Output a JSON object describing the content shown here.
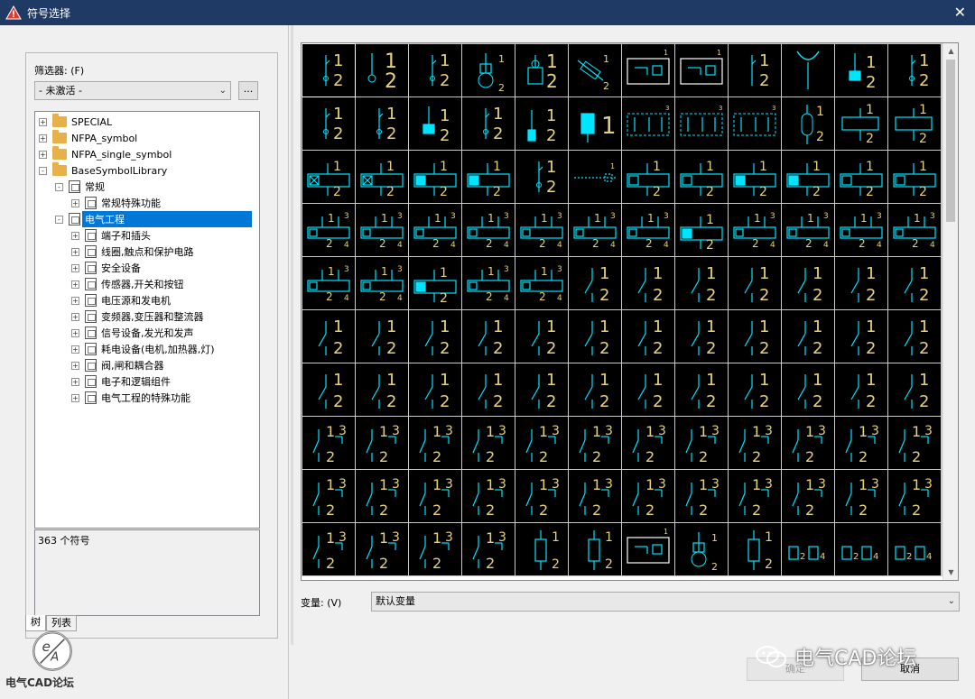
{
  "window": {
    "title": "符号选择",
    "close_glyph": "✕"
  },
  "filter": {
    "label": "筛选器: (F)",
    "value": "- 未激活 -",
    "browse_label": "..."
  },
  "tree": {
    "items": [
      {
        "label": "SPECIAL",
        "level": 0,
        "expander": "+",
        "icon": "folder-icon"
      },
      {
        "label": "NFPA_symbol",
        "level": 0,
        "expander": "+",
        "icon": "folder-icon"
      },
      {
        "label": "NFPA_single_symbol",
        "level": 0,
        "expander": "+",
        "icon": "folder-icon"
      },
      {
        "label": "BaseSymbolLibrary",
        "level": 0,
        "expander": "-",
        "icon": "folder-icon"
      },
      {
        "label": "常规",
        "level": 1,
        "expander": "-",
        "icon": "symbol-icon"
      },
      {
        "label": "常规特殊功能",
        "level": 2,
        "expander": "+",
        "icon": "symbol-icon"
      },
      {
        "label": "电气工程",
        "level": 1,
        "expander": "-",
        "icon": "symbol-icon",
        "selected": true
      },
      {
        "label": "端子和插头",
        "level": 2,
        "expander": "+",
        "icon": "symbol-icon"
      },
      {
        "label": "线圈,触点和保护电路",
        "level": 2,
        "expander": "+",
        "icon": "symbol-icon"
      },
      {
        "label": "安全设备",
        "level": 2,
        "expander": "+",
        "icon": "symbol-icon"
      },
      {
        "label": "传感器,开关和按钮",
        "level": 2,
        "expander": "+",
        "icon": "symbol-icon"
      },
      {
        "label": "电压源和发电机",
        "level": 2,
        "expander": "+",
        "icon": "symbol-icon"
      },
      {
        "label": "变频器,变压器和整流器",
        "level": 2,
        "expander": "+",
        "icon": "symbol-icon"
      },
      {
        "label": "信号设备,发光和发声",
        "level": 2,
        "expander": "+",
        "icon": "symbol-icon"
      },
      {
        "label": "耗电设备(电机,加热器,灯)",
        "level": 2,
        "expander": "+",
        "icon": "symbol-icon"
      },
      {
        "label": "阀,闸和耦合器",
        "level": 2,
        "expander": "+",
        "icon": "symbol-icon"
      },
      {
        "label": "电子和逻辑组件",
        "level": 2,
        "expander": "+",
        "icon": "symbol-icon"
      },
      {
        "label": "电气工程的特殊功能",
        "level": 2,
        "expander": "+",
        "icon": "symbol-icon"
      }
    ]
  },
  "count_text": "363 个符号",
  "tabs": [
    {
      "label": "树",
      "active": true
    },
    {
      "label": "列表",
      "active": false
    }
  ],
  "variant": {
    "label": "变量: (V)",
    "value": "默认变量"
  },
  "buttons": {
    "ok": "确定",
    "cancel": "取消"
  },
  "watermark": {
    "right_text": "电气CAD论坛",
    "left_text": "电气CAD论坛"
  },
  "colors": {
    "titlebar": "#1f3a64",
    "symbol_bg": "#000000",
    "symbol_cyan": "#00e5ff",
    "symbol_yellow": "#e6d27a",
    "selection": "#0078d7"
  },
  "symbols": {
    "rows": 10,
    "cols": 12,
    "kinds": [
      [
        "pin",
        "terminal",
        "pin2",
        "lamp",
        "plug",
        "fuse",
        "box-s",
        "box-s2",
        "stick",
        "fork",
        "bulb",
        "pin3"
      ],
      [
        "pin4",
        "pin5",
        "bulb2",
        "pin6",
        "blue-pin",
        "blue-big",
        "box-dash",
        "box-dash2",
        "box-dash3",
        "capsule",
        "coil",
        "coil2"
      ],
      [
        "coilx",
        "coilx",
        "coilf",
        "coilf",
        "pin1",
        "dash",
        "coilm",
        "coilm",
        "coilf",
        "coilf",
        "coilh",
        "coilh"
      ],
      [
        "coil3",
        "coil3",
        "coil3",
        "coil3",
        "coil3",
        "coil3",
        "coil3",
        "coilf",
        "coil3",
        "coil3",
        "coil3",
        "coil3"
      ],
      [
        "coil4",
        "coil4",
        "coilf",
        "coil4",
        "coil4",
        "sw",
        "sw",
        "sw",
        "sw",
        "sw",
        "sw",
        "sw"
      ],
      [
        "sw",
        "sw",
        "sw",
        "sw",
        "sw",
        "sw",
        "sw",
        "sw",
        "sw",
        "sw",
        "sw",
        "sw"
      ],
      [
        "sw",
        "sw",
        "sw",
        "sw",
        "sw",
        "sw",
        "sw",
        "sw",
        "sw",
        "sw",
        "sw",
        "sw"
      ],
      [
        "sw3",
        "sw3",
        "sw3",
        "sw3",
        "sw3",
        "sw3",
        "sw3",
        "sw3",
        "sw3",
        "sw3",
        "sw3",
        "sw3"
      ],
      [
        "sw3",
        "sw3",
        "sw3",
        "sw3",
        "sw3",
        "sw3",
        "sw3",
        "sw3",
        "sw3",
        "sw3",
        "sw3",
        "sw3"
      ],
      [
        "sw3",
        "sw3",
        "sw3",
        "sw3",
        "res",
        "res",
        "box-r",
        "lamp2",
        "res2",
        "cap",
        "cap",
        "cap"
      ]
    ],
    "digits": {
      "one": "1",
      "two": "2",
      "three": "3",
      "four": "4",
      "five": "5",
      "six": "6"
    }
  }
}
